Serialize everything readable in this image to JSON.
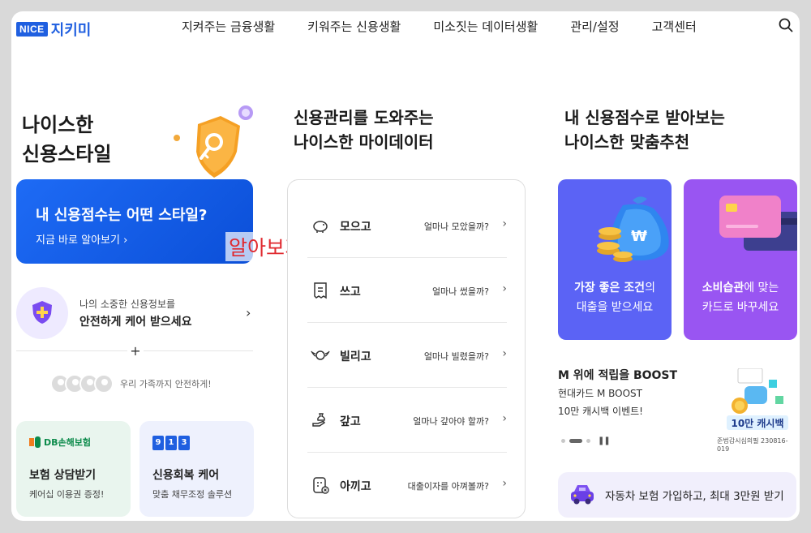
{
  "header": {
    "logo_badge": "NICE",
    "logo_name": "지키미",
    "nav": [
      "지켜주는 금융생활",
      "키워주는 신용생활",
      "미소짓는 데이터생활",
      "관리/설정",
      "고객센터"
    ]
  },
  "hero": {
    "title_line1": "나이스한",
    "title_line2": "신용스타일",
    "card_title": "내 신용점수는 어떤 스타일?",
    "card_link": "지금 바로 알아보기 ›",
    "overlay_label": "알아보기"
  },
  "care": {
    "sub": "나의 소중한 신용정보를",
    "main": "안전하게 케어 받으세요",
    "chevron": "›",
    "plus": "+",
    "family_text": "우리 가족까지 안전하게!"
  },
  "mini_cards": [
    {
      "brand": "DB손해보험",
      "title": "보험 상담받기",
      "sub": "케어십 이용권 증정!"
    },
    {
      "brand": "913",
      "title": "신용회복 케어",
      "sub": "맞춤 채무조정 솔루션"
    }
  ],
  "mydata": {
    "title_line1": "신용관리를 도와주는",
    "title_line2": "나이스한 마이데이터",
    "items": [
      {
        "label": "모으고",
        "question": "얼마나 모았을까?"
      },
      {
        "label": "쓰고",
        "question": "얼마나 썼을까?"
      },
      {
        "label": "빌리고",
        "question": "얼마나 빌렸을까?"
      },
      {
        "label": "갚고",
        "question": "얼마나 갚아야 할까?"
      },
      {
        "label": "아끼고",
        "question": "대출이자를 아껴볼까?"
      }
    ],
    "chevron": "›"
  },
  "recommend": {
    "title_line1": "내 신용점수로 받아보는",
    "title_line2": "나이스한 맞춤추천",
    "cards": [
      {
        "bold": "가장 좋은 조건",
        "rest1": "의",
        "line2": "대출을 받으세요"
      },
      {
        "bold": "소비습관",
        "rest1": "에 맞는",
        "line2": "카드로 바꾸세요"
      }
    ],
    "boost_title": "M 위에 적립을 BOOST",
    "boost_line1": "현대카드 M BOOST",
    "boost_line2": "10만 캐시백 이벤트!",
    "boost_badge": "10만 캐시백",
    "boost_note": "준법감시심의필 230816-019",
    "pause": "❚❚",
    "car_banner": "자동차 보험 가입하고, 최대 3만원 받기"
  },
  "colors": {
    "brand": "#1f5fe0",
    "overlay": "#e0292f",
    "rec_a": "#5b63f5",
    "rec_b": "#9955f2"
  }
}
